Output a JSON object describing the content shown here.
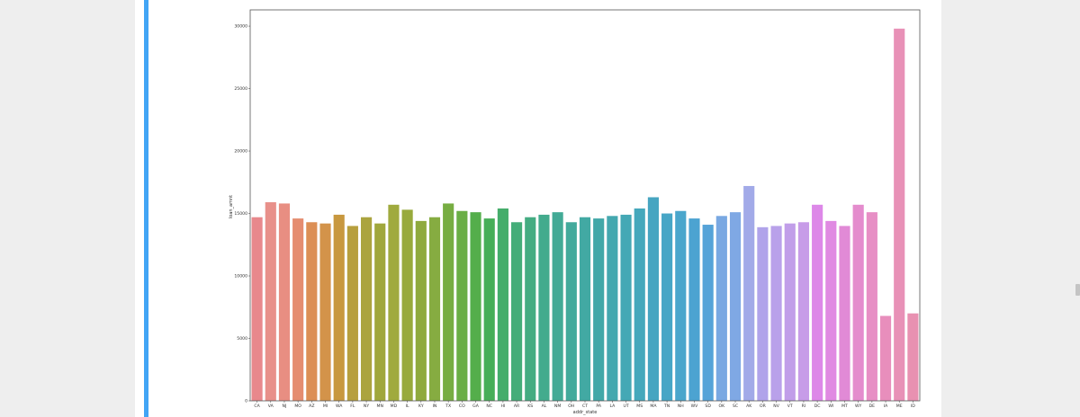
{
  "chart_data": {
    "type": "bar",
    "xlabel": "addr_state",
    "ylabel": "loan_amnt",
    "ylim": [
      0,
      31300
    ],
    "yticks": [
      0,
      5000,
      10000,
      15000,
      20000,
      25000,
      30000
    ],
    "grid": false,
    "categories": [
      "CA",
      "VA",
      "NJ",
      "MO",
      "AZ",
      "MI",
      "WA",
      "FL",
      "NY",
      "MN",
      "MD",
      "IL",
      "KY",
      "IN",
      "TX",
      "CO",
      "GA",
      "NC",
      "HI",
      "AR",
      "KS",
      "AL",
      "NM",
      "OH",
      "CT",
      "PA",
      "LA",
      "UT",
      "MS",
      "MA",
      "TN",
      "NH",
      "WV",
      "SD",
      "OK",
      "SC",
      "AK",
      "OR",
      "NV",
      "VT",
      "RI",
      "DC",
      "WI",
      "MT",
      "WY",
      "DE",
      "IA",
      "ME",
      "ID"
    ],
    "values": [
      14700,
      15900,
      15800,
      14600,
      14300,
      14200,
      14900,
      14000,
      14700,
      14200,
      15700,
      15300,
      14400,
      14700,
      15800,
      15200,
      15100,
      14600,
      15400,
      14300,
      14700,
      14900,
      15100,
      14300,
      14700,
      14600,
      14800,
      14900,
      15400,
      16300,
      15000,
      15200,
      14600,
      14100,
      14800,
      15100,
      17200,
      13900,
      14000,
      14200,
      14300,
      15700,
      14400,
      14000,
      15700,
      15100,
      6800,
      29800,
      7000
    ],
    "colors": [
      "#e8888c",
      "#e8908a",
      "#e88e82",
      "#e58d70",
      "#dc8f55",
      "#d3934a",
      "#c8983f",
      "#b79f3e",
      "#aba43f",
      "#a0a73c",
      "#a0aa3e",
      "#98aa3c",
      "#8faa3e",
      "#86ac41",
      "#77ad42",
      "#6aae45",
      "#54ae4b",
      "#47ae58",
      "#45ad6b",
      "#44ad79",
      "#44ac82",
      "#43ab8d",
      "#42aa96",
      "#43aa9c",
      "#42a9a3",
      "#42a8a8",
      "#44a8af",
      "#44a8b5",
      "#45a8bc",
      "#46a5c1",
      "#47a6c6",
      "#4aa6cc",
      "#4ca3d1",
      "#55a3d8",
      "#79a8e2",
      "#7fa8e4",
      "#a2aae8",
      "#b0a3ea",
      "#b9a1ea",
      "#c19ee9",
      "#c79ce8",
      "#dd88e8",
      "#e08ae2",
      "#e18ad6",
      "#e48ccd",
      "#e78fc5",
      "#e88ebc",
      "#e891b7",
      "#e891b1"
    ]
  }
}
